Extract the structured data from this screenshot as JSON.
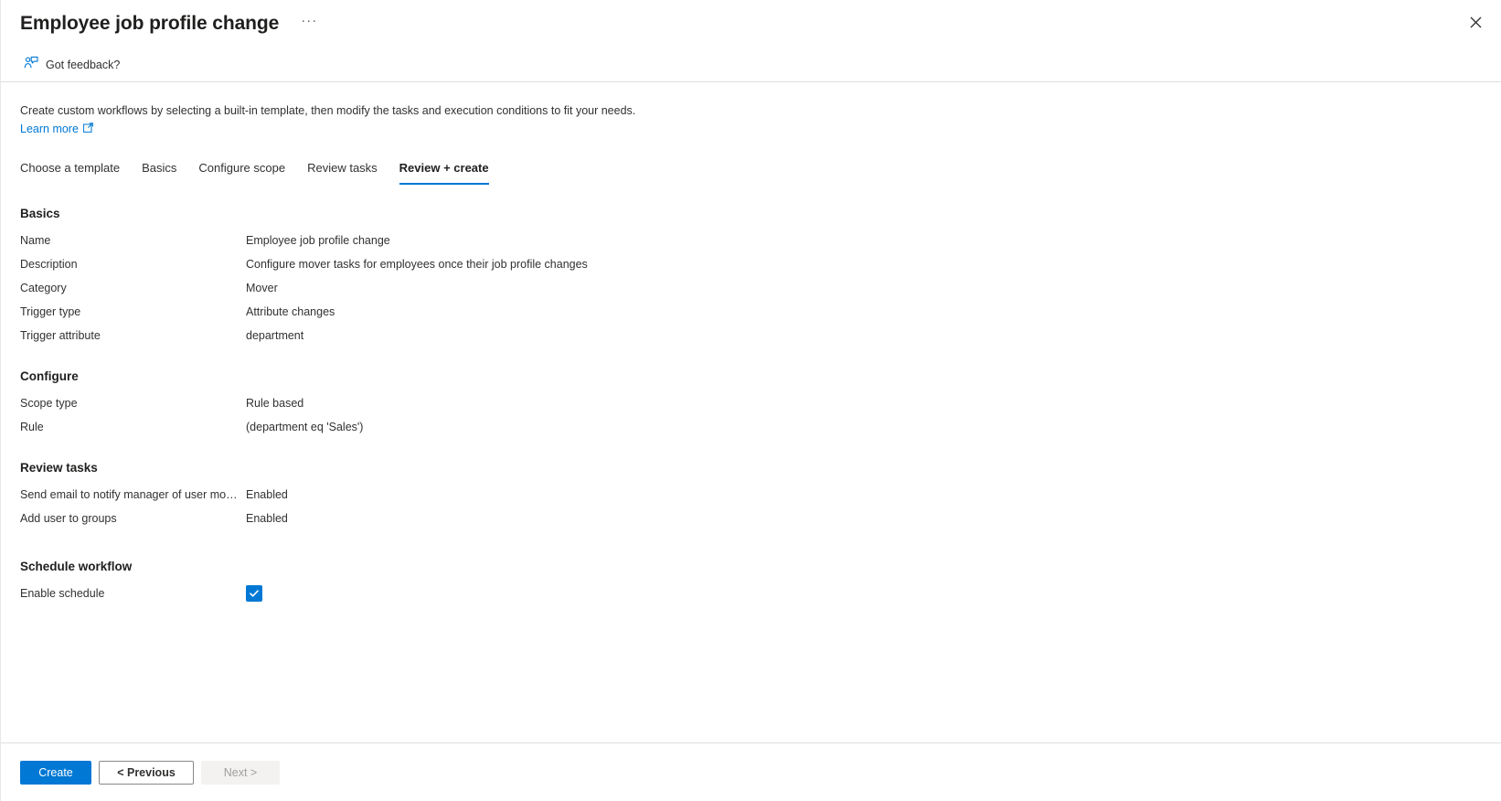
{
  "header": {
    "title": "Employee job profile change",
    "more_menu": "···",
    "close_label": "Close"
  },
  "command_bar": {
    "feedback_label": "Got feedback?"
  },
  "intro": {
    "description": "Create custom workflows by selecting a built-in template, then modify the tasks and execution conditions to fit your needs.",
    "learn_more_label": "Learn more"
  },
  "tabs": [
    {
      "label": "Choose a template",
      "active": false
    },
    {
      "label": "Basics",
      "active": false
    },
    {
      "label": "Configure scope",
      "active": false
    },
    {
      "label": "Review tasks",
      "active": false
    },
    {
      "label": "Review + create",
      "active": true
    }
  ],
  "sections": [
    {
      "heading": "Basics",
      "rows": [
        {
          "label": "Name",
          "value": "Employee job profile change"
        },
        {
          "label": "Description",
          "value": "Configure mover tasks for employees once their job profile changes"
        },
        {
          "label": "Category",
          "value": "Mover"
        },
        {
          "label": "Trigger type",
          "value": "Attribute changes"
        },
        {
          "label": "Trigger attribute",
          "value": "department"
        }
      ]
    },
    {
      "heading": "Configure",
      "rows": [
        {
          "label": "Scope type",
          "value": "Rule based"
        },
        {
          "label": "Rule",
          "value": "(department eq 'Sales')"
        }
      ]
    },
    {
      "heading": "Review tasks",
      "rows": [
        {
          "label": "Send email to notify manager of user mo…",
          "value": "Enabled"
        },
        {
          "label": "Add user to groups",
          "value": "Enabled"
        }
      ]
    }
  ],
  "schedule": {
    "heading": "Schedule workflow",
    "enable_label": "Enable schedule",
    "enabled": true
  },
  "footer": {
    "create_label": "Create",
    "previous_label": "< Previous",
    "next_label": "Next >"
  },
  "colors": {
    "accent": "#0078d4",
    "text": "#323130",
    "divider": "#e1dfdd"
  }
}
